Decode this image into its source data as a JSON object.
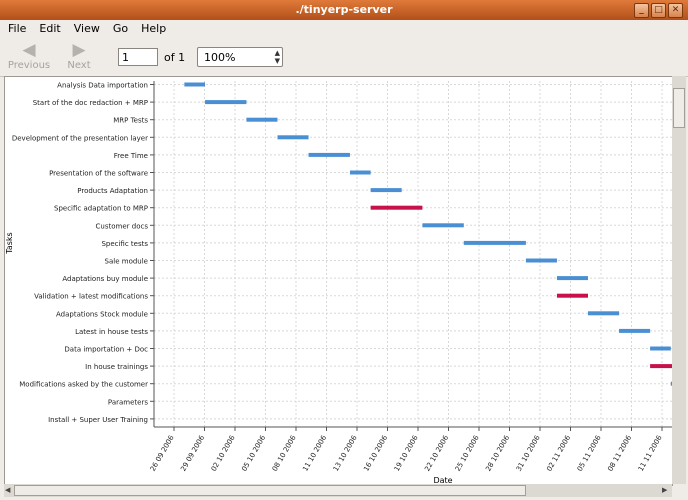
{
  "window": {
    "title": "./tinyerp-server",
    "close": "✕",
    "maximize": "□",
    "minimize": "_"
  },
  "menu": [
    "File",
    "Edit",
    "View",
    "Go",
    "Help"
  ],
  "toolbar": {
    "previous_label": "Previous",
    "next_label": "Next",
    "page_value": "1",
    "page_of": "of 1",
    "zoom_value": "100%"
  },
  "chart_data": {
    "type": "gantt",
    "xlabel": "Date",
    "ylabel": "Tasks",
    "colors": {
      "normal": "#4a8fd4",
      "critical": "#c8104a"
    },
    "x_ticks": [
      "26 09 2006",
      "29 09 2006",
      "02 10 2006",
      "05 10 2006",
      "08 10 2006",
      "11 10 2006",
      "13 10 2006",
      "16 10 2006",
      "19 10 2006",
      "22 10 2006",
      "25 10 2006",
      "28 10 2006",
      "31 10 2006",
      "02 11 2006",
      "05 11 2006",
      "08 11 2006",
      "11 11 2006",
      "14 1"
    ],
    "tasks": [
      {
        "name": "Analysis Data importation",
        "start": "2006-09-27",
        "end": "2006-09-29",
        "critical": false
      },
      {
        "name": "Start of the doc redaction + MRP",
        "start": "2006-09-29",
        "end": "2006-10-03",
        "critical": false
      },
      {
        "name": "MRP Tests",
        "start": "2006-10-03",
        "end": "2006-10-06",
        "critical": false
      },
      {
        "name": "Development of the presentation layer",
        "start": "2006-10-06",
        "end": "2006-10-09",
        "critical": false
      },
      {
        "name": "Free Time",
        "start": "2006-10-09",
        "end": "2006-10-13",
        "critical": false
      },
      {
        "name": "Presentation of the software",
        "start": "2006-10-13",
        "end": "2006-10-15",
        "critical": false
      },
      {
        "name": "Products Adaptation",
        "start": "2006-10-15",
        "end": "2006-10-18",
        "critical": false
      },
      {
        "name": "Specific adaptation to MRP",
        "start": "2006-10-15",
        "end": "2006-10-20",
        "critical": true
      },
      {
        "name": "Customer docs",
        "start": "2006-10-20",
        "end": "2006-10-24",
        "critical": false
      },
      {
        "name": "Specific tests",
        "start": "2006-10-24",
        "end": "2006-10-30",
        "critical": false
      },
      {
        "name": "Sale module",
        "start": "2006-10-30",
        "end": "2006-11-02",
        "critical": false
      },
      {
        "name": "Adaptations buy module",
        "start": "2006-11-02",
        "end": "2006-11-05",
        "critical": false
      },
      {
        "name": "Validation + latest modifications",
        "start": "2006-11-02",
        "end": "2006-11-05",
        "critical": true
      },
      {
        "name": "Adaptations Stock module",
        "start": "2006-11-05",
        "end": "2006-11-08",
        "critical": false
      },
      {
        "name": "Latest in house tests",
        "start": "2006-11-08",
        "end": "2006-11-11",
        "critical": false
      },
      {
        "name": "Data importation + Doc",
        "start": "2006-11-11",
        "end": "2006-11-13",
        "critical": false
      },
      {
        "name": "In house trainings",
        "start": "2006-11-11",
        "end": "2006-11-14",
        "critical": true
      },
      {
        "name": "Modifications asked by the customer",
        "start": "2006-11-13",
        "end": "2006-11-14",
        "critical": false
      },
      {
        "name": "Parameters",
        "start": null,
        "end": null,
        "critical": false
      },
      {
        "name": "Install + Super User Training",
        "start": null,
        "end": null,
        "critical": false
      }
    ]
  }
}
